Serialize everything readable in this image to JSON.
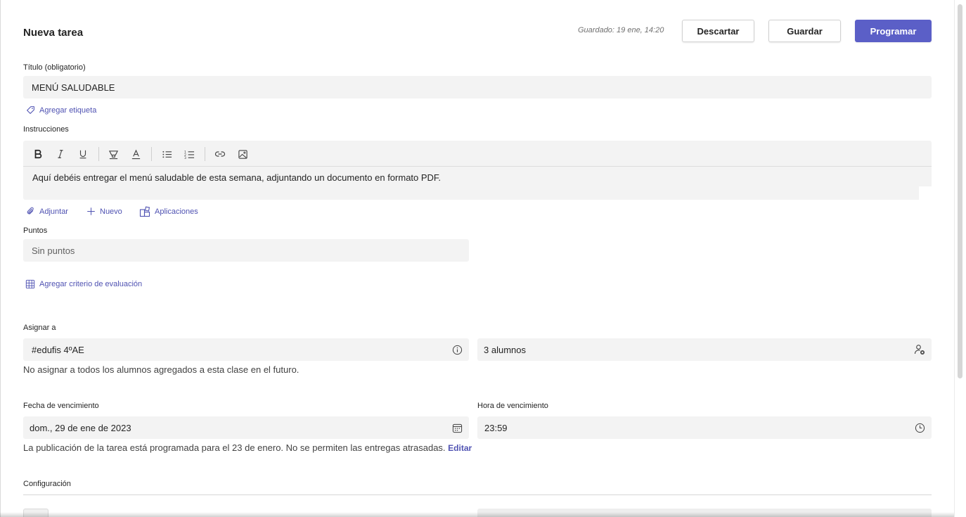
{
  "header": {
    "title": "Nueva tarea",
    "saved_status": "Guardado: 19 ene, 14:20",
    "discard_label": "Descartar",
    "save_label": "Guardar",
    "schedule_label": "Programar"
  },
  "title_field": {
    "label": "Título (obligatorio)",
    "value": "MENÚ SALUDABLE"
  },
  "add_tag_label": "Agregar etiqueta",
  "instructions": {
    "label": "Instrucciones",
    "toolbar": [
      "bold-icon",
      "italic-icon",
      "underline-icon",
      "highlight-icon",
      "font-color-icon",
      "bullet-list-icon",
      "numbered-list-icon",
      "link-icon",
      "image-icon"
    ],
    "text": "Aquí debéis entregar el menú saludable de esta semana, adjuntando un documento en formato PDF."
  },
  "attachments": {
    "attach_label": "Adjuntar",
    "new_label": "Nuevo",
    "apps_label": "Aplicaciones"
  },
  "points": {
    "label": "Puntos",
    "value": "Sin puntos"
  },
  "rubric_label": "Agregar criterio de evaluación",
  "assign": {
    "label": "Asignar a",
    "class_value": "#edufis 4ºAE",
    "students_value": "3 alumnos",
    "note": "No asignar a todos los alumnos agregados a esta clase en el futuro."
  },
  "due": {
    "date_label": "Fecha de vencimiento",
    "date_value": "dom., 29 de ene de 2023",
    "time_label": "Hora de vencimiento",
    "time_value": "23:59",
    "note": "La publicación de la tarea está programada para el 23 de enero. No se permiten las entregas atrasadas.",
    "edit_label": "Editar"
  },
  "settings_label": "Configuración",
  "colors": {
    "accent": "#5b5fc7",
    "link": "#4f52b2",
    "field_bg": "#f3f3f3"
  }
}
